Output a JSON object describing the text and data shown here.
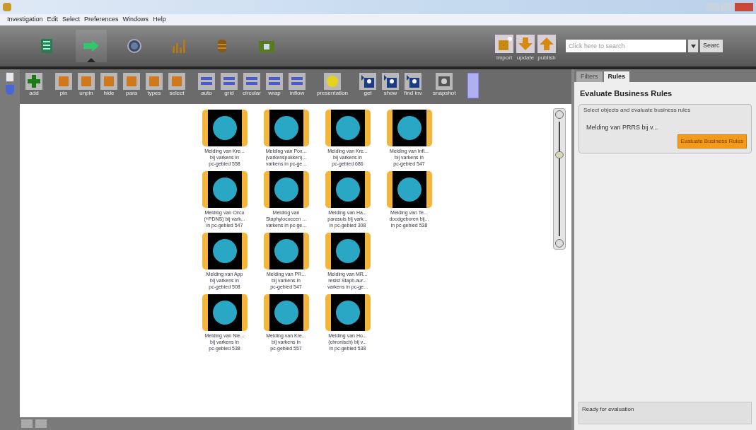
{
  "menu": [
    "Investigation",
    "Edit",
    "Select",
    "Preferences",
    "Windows",
    "Help"
  ],
  "nav": [
    {
      "kind": "table",
      "selected": false
    },
    {
      "kind": "arrow",
      "selected": true
    },
    {
      "kind": "globe",
      "selected": false
    },
    {
      "kind": "chart",
      "selected": false
    },
    {
      "kind": "database",
      "selected": false
    },
    {
      "kind": "folder",
      "selected": false
    }
  ],
  "top_actions": [
    {
      "kind": "import",
      "label": "import"
    },
    {
      "kind": "down",
      "label": "update"
    },
    {
      "kind": "up",
      "label": "publish"
    }
  ],
  "search": {
    "placeholder": "Click here to search",
    "button": "Searc"
  },
  "tools": [
    {
      "kind": "add",
      "label": "add"
    },
    {
      "kind": "edit",
      "label": "pin"
    },
    {
      "kind": "edit",
      "label": "unpin"
    },
    {
      "kind": "edit",
      "label": "hide"
    },
    {
      "kind": "edit",
      "label": "para"
    },
    {
      "kind": "edit",
      "label": "types"
    },
    {
      "kind": "edit",
      "label": "select"
    },
    {
      "kind": "layout",
      "label": "auto"
    },
    {
      "kind": "layout",
      "label": "grid"
    },
    {
      "kind": "layout",
      "label": "circular"
    },
    {
      "kind": "layout",
      "label": "wrap"
    },
    {
      "kind": "layout",
      "label": "inflow"
    },
    {
      "kind": "present",
      "label": "presentation"
    },
    {
      "kind": "expand",
      "label": "get"
    },
    {
      "kind": "expand",
      "label": "show"
    },
    {
      "kind": "expand",
      "label": "find inv"
    },
    {
      "kind": "snapshot",
      "label": "snapshot"
    }
  ],
  "nodes": [
    {
      "lines": [
        "Melding van Kre...",
        "bij varkens in",
        "pc-gebied 558"
      ]
    },
    {
      "lines": [
        "Melding van Pox...",
        "(varkenspokken)...",
        "varkens in pc-ge..."
      ]
    },
    {
      "lines": [
        "Melding van Kre...",
        "bij varkens in",
        "pc-gebied 686"
      ]
    },
    {
      "lines": [
        "Melding van Infl...",
        "bij varkens in",
        "pc-gebied 547"
      ]
    },
    {
      "lines": [
        "Melding van Circo",
        "(+PDNS) bij vark...",
        "in pc-gebied 547"
      ]
    },
    {
      "lines": [
        "Melding van",
        "Staphylococcen ...",
        "varkens in pc-ge..."
      ]
    },
    {
      "lines": [
        "Melding van Ha...",
        "parasuis bij vark...",
        "in pc-gebied 308"
      ]
    },
    {
      "lines": [
        "Melding van Te...",
        "doodgeboren bij...",
        "in pc-gebied 538"
      ]
    },
    {
      "lines": [
        "Melding van App",
        "bij varkens in",
        "pc-gebied 508"
      ]
    },
    {
      "lines": [
        "Melding van PR...",
        "bij varkens in",
        "pc-gebied 547"
      ]
    },
    {
      "lines": [
        "Melding van MR...",
        "resist Staph.aur...",
        "varkens in pc-ge..."
      ]
    },
    {
      "lines": [
        "Melding van Nie...",
        "bij varkens in",
        "pc-gebied 538"
      ]
    },
    {
      "lines": [
        "Melding van Kre...",
        "bij varkens in",
        "pc-gebied 557"
      ]
    },
    {
      "lines": [
        "Melding van Ho...",
        "(chronisch) bij v...",
        "in pc-gebied 538"
      ]
    }
  ],
  "zoom": {
    "level": 0.74
  },
  "panel": {
    "tabs": [
      {
        "label": "Filters",
        "selected": false
      },
      {
        "label": "Rules",
        "selected": true
      }
    ],
    "heading": "Evaluate Business Rules",
    "group_title": "Select objects and evaluate business rules",
    "selection": "Melding van PRRS bij v...",
    "button": "Evaluate Business Rules",
    "status": "Ready for evaluation"
  }
}
